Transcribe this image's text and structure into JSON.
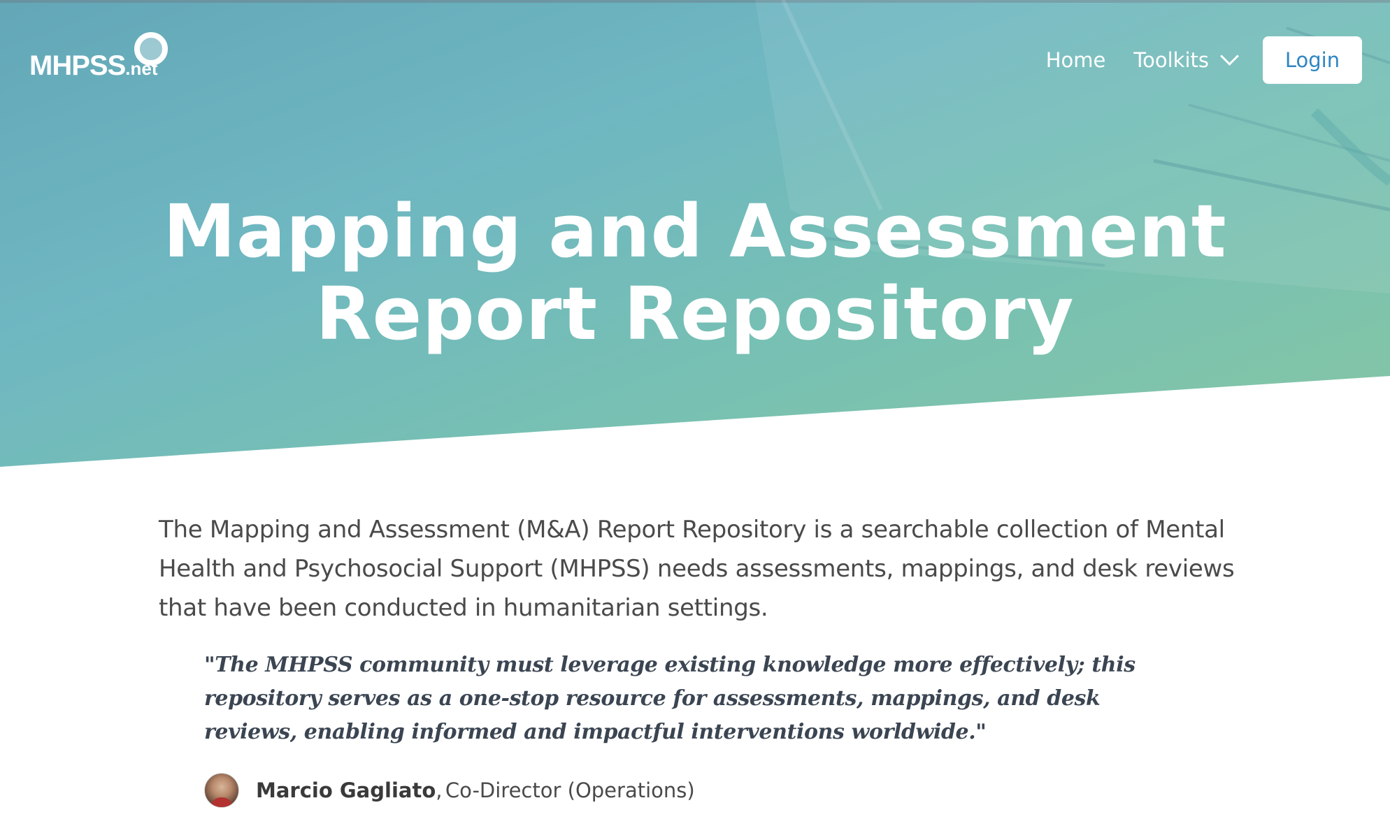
{
  "header": {
    "logo_main": "MHPSS",
    "logo_suffix": ".net",
    "nav": {
      "home": "Home",
      "toolkits": "Toolkits",
      "login": "Login"
    }
  },
  "hero": {
    "title_line1": "Mapping and Assessment",
    "title_line2": "Report Repository"
  },
  "main": {
    "intro": "The Mapping and Assessment (M&A) Report Repository is a searchable collection of Mental Health and Psychosocial Support (MHPSS) needs assessments, mappings, and desk reviews that have been conducted in humanitarian settings.",
    "quote": "\"The MHPSS community must leverage existing knowledge more effectively; this repository serves as a one-stop resource for assessments, mappings, and desk reviews, enabling informed and impactful interventions worldwide.\"",
    "author": {
      "name": "Marcio Gagliato",
      "separator": ",",
      "role": "Co-Director (Operations)"
    }
  },
  "colors": {
    "hero_gradient_start": "#63a7b8",
    "hero_gradient_end": "#86c6a4",
    "login_text": "#2f86c2",
    "quote_text": "#3b4552"
  }
}
